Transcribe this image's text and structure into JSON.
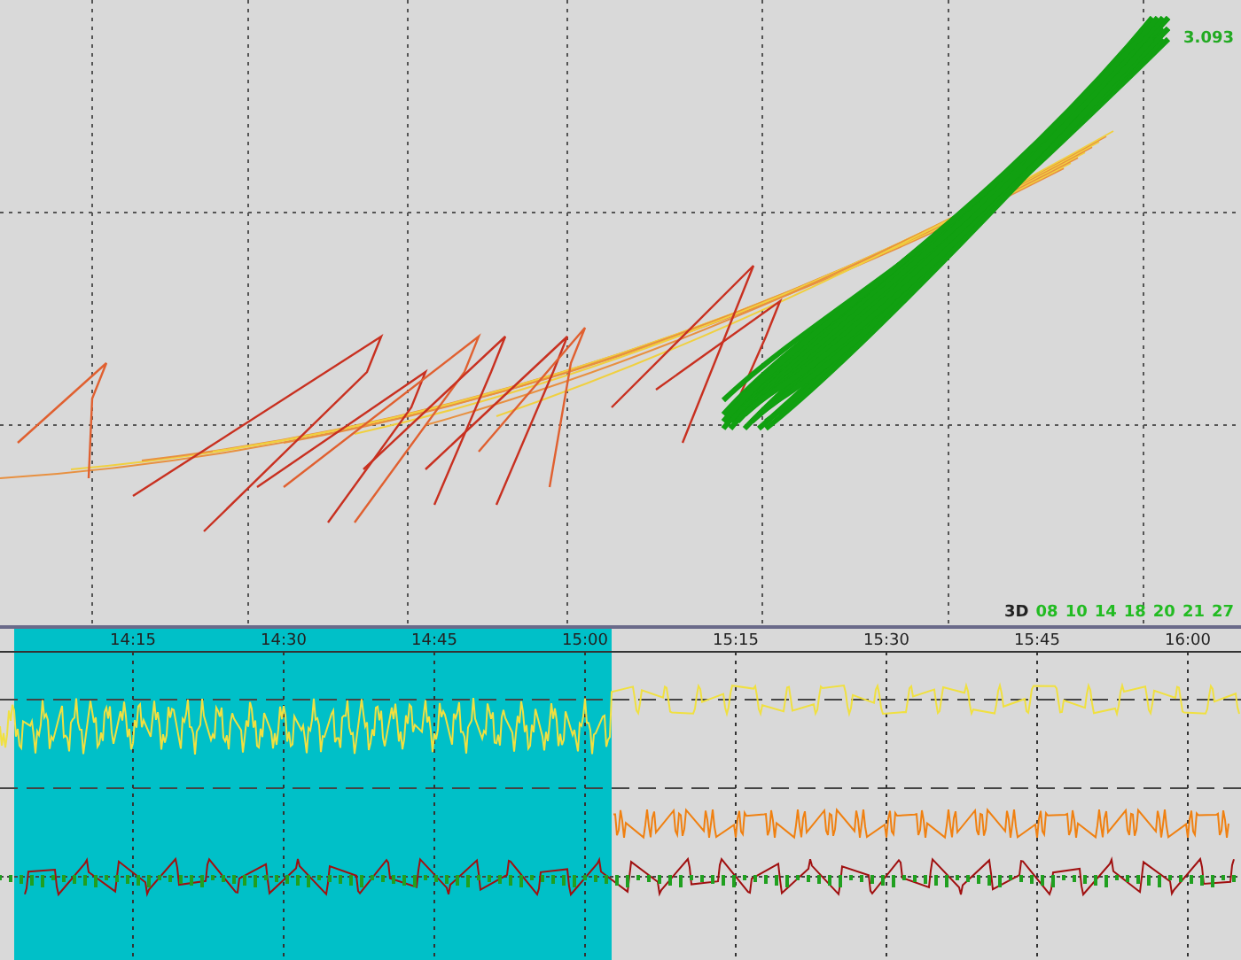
{
  "top_plot": {
    "value_label": "3.093"
  },
  "legend": {
    "prefix": "3D",
    "items": [
      "08",
      "10",
      "14",
      "18",
      "20",
      "21",
      "27"
    ]
  },
  "timeline": {
    "ticks": [
      "14:15",
      "14:30",
      "14:45",
      "15:00",
      "15:15",
      "15:30",
      "15:45",
      "16:00"
    ]
  }
}
